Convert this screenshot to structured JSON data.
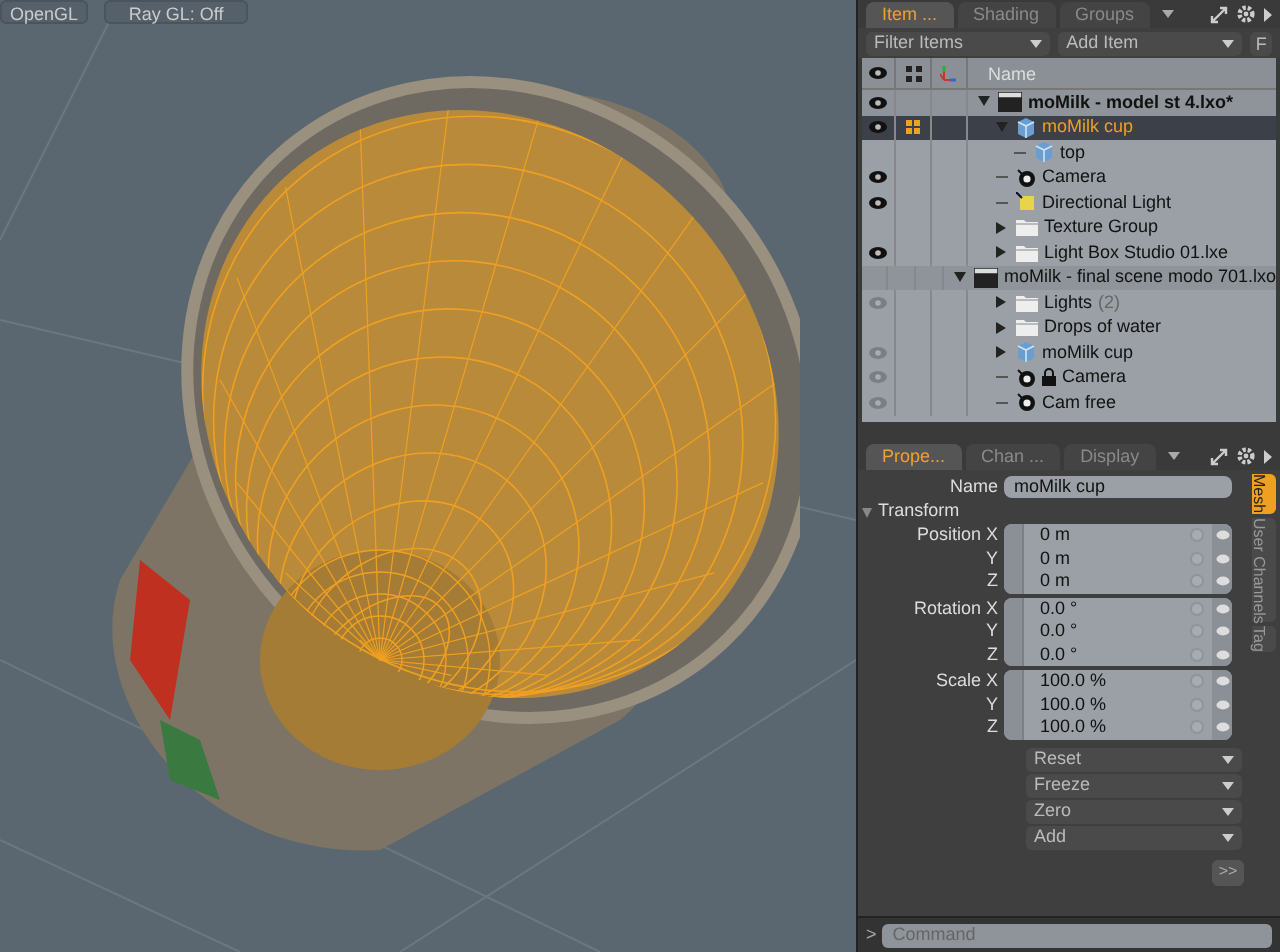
{
  "viewport": {
    "buttons": [
      "OpenGL",
      "Ray GL: Off"
    ]
  },
  "item_panel": {
    "tabs": [
      {
        "label": "Item ...",
        "selected": true
      },
      {
        "label": "Shading",
        "selected": false
      },
      {
        "label": "Groups",
        "selected": false
      }
    ],
    "filter": "Filter Items",
    "add": "Add Item",
    "f_button": "F",
    "header": "Name",
    "tree": [
      {
        "label": "moMilk - model st 4.lxo*",
        "kind": "scene",
        "bold": true,
        "visible": true,
        "dimmed": false,
        "selected": false,
        "expanded": true,
        "children": [
          {
            "label": "moMilk cup",
            "kind": "mesh",
            "visible": true,
            "dimmed": false,
            "selected": true,
            "expanded": true,
            "children": [
              {
                "label": "top",
                "kind": "mesh",
                "visible": false,
                "selected": false
              }
            ]
          },
          {
            "label": "Camera",
            "kind": "camera",
            "visible": true,
            "dimmed": false,
            "selected": false
          },
          {
            "label": "Directional Light",
            "kind": "light",
            "visible": true,
            "dimmed": false,
            "selected": false
          },
          {
            "label": "Texture Group",
            "kind": "group",
            "visible": false,
            "selected": false,
            "expanded": false
          },
          {
            "label": "Light Box Studio 01.lxe",
            "kind": "group",
            "visible": true,
            "dimmed": false,
            "selected": false,
            "expanded": false
          }
        ]
      },
      {
        "label": "moMilk - final scene modo 701.lxo",
        "kind": "scene",
        "bold": false,
        "visible": false,
        "selected": false,
        "expanded": true,
        "children": [
          {
            "label": "Lights",
            "count": "(2)",
            "kind": "group",
            "visible": true,
            "dimmed": true,
            "selected": false,
            "expanded": false
          },
          {
            "label": "Drops of water",
            "kind": "group",
            "visible": false,
            "selected": false,
            "expanded": false
          },
          {
            "label": "moMilk cup",
            "kind": "mesh",
            "visible": true,
            "dimmed": true,
            "selected": false,
            "expanded": false
          },
          {
            "label": "Camera",
            "kind": "camera",
            "locked": true,
            "visible": true,
            "dimmed": true,
            "selected": false
          },
          {
            "label": "Cam free",
            "kind": "camera",
            "visible": true,
            "dimmed": true,
            "selected": false
          }
        ]
      }
    ]
  },
  "properties_panel": {
    "tabs": [
      {
        "label": "Prope...",
        "selected": true
      },
      {
        "label": "Chan ...",
        "selected": false
      },
      {
        "label": "Display",
        "selected": false
      }
    ],
    "name_label": "Name",
    "name_value": "moMilk cup",
    "section": "Transform",
    "groups": [
      {
        "rows": [
          {
            "label": "Position X",
            "value": "0 m"
          },
          {
            "label": "Y",
            "value": "0 m"
          },
          {
            "label": "Z",
            "value": "0 m"
          }
        ]
      },
      {
        "rows": [
          {
            "label": "Rotation X",
            "value": "0.0 °"
          },
          {
            "label": "Y",
            "value": "0.0 °"
          },
          {
            "label": "Z",
            "value": "0.0 °"
          }
        ]
      },
      {
        "rows": [
          {
            "label": "Scale X",
            "value": "100.0 %"
          },
          {
            "label": "Y",
            "value": "100.0 %"
          },
          {
            "label": "Z",
            "value": "100.0 %"
          }
        ]
      }
    ],
    "actions": [
      "Reset",
      "Freeze",
      "Zero",
      "Add"
    ],
    "more": ">>",
    "side_tabs": [
      {
        "label": "Mesh",
        "selected": true
      },
      {
        "label": "User Channels",
        "selected": false
      },
      {
        "label": "Tag",
        "selected": false
      }
    ]
  },
  "command_bar": {
    "prompt": ">",
    "placeholder": "Command"
  }
}
